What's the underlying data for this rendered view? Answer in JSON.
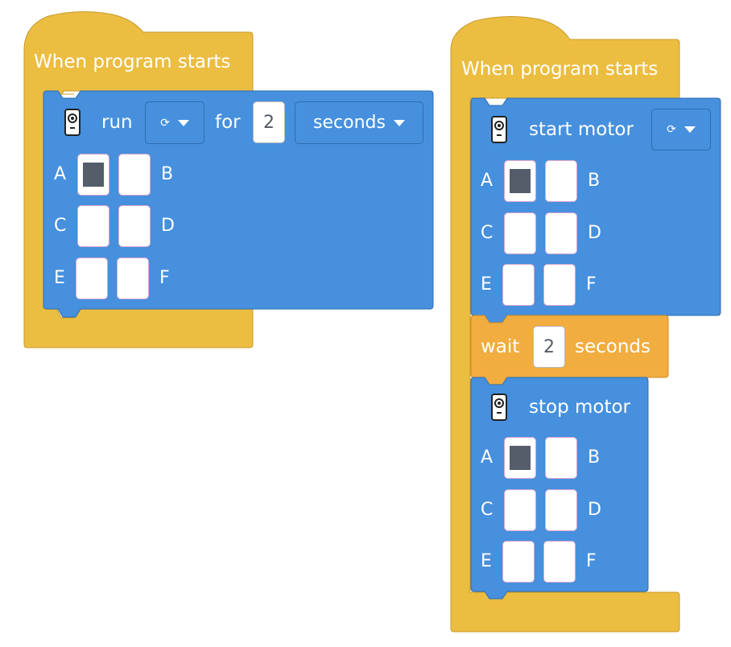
{
  "colors": {
    "hat": "#ebbd41",
    "motor": "#4690de",
    "wait": "#f1ad3f",
    "port_fill": "#555d6b"
  },
  "stack1": {
    "hat_label": "When program starts",
    "block": {
      "icon": "motor-icon",
      "run_label": "run",
      "direction": "⟳",
      "for_label": "for",
      "amount": "2",
      "unit": "seconds",
      "ports": [
        {
          "label": "A",
          "selected": true
        },
        {
          "label": "B",
          "selected": false
        },
        {
          "label": "C",
          "selected": false
        },
        {
          "label": "D",
          "selected": false
        },
        {
          "label": "E",
          "selected": false
        },
        {
          "label": "F",
          "selected": false
        }
      ]
    }
  },
  "stack2": {
    "hat_label": "When program starts",
    "start_block": {
      "icon": "motor-icon",
      "label": "start motor",
      "direction": "⟳",
      "ports": [
        {
          "label": "A",
          "selected": true
        },
        {
          "label": "B",
          "selected": false
        },
        {
          "label": "C",
          "selected": false
        },
        {
          "label": "D",
          "selected": false
        },
        {
          "label": "E",
          "selected": false
        },
        {
          "label": "F",
          "selected": false
        }
      ]
    },
    "wait_block": {
      "wait_label": "wait",
      "amount": "2",
      "unit_label": "seconds"
    },
    "stop_block": {
      "icon": "motor-icon",
      "label": "stop motor",
      "ports": [
        {
          "label": "A",
          "selected": true
        },
        {
          "label": "B",
          "selected": false
        },
        {
          "label": "C",
          "selected": false
        },
        {
          "label": "D",
          "selected": false
        },
        {
          "label": "E",
          "selected": false
        },
        {
          "label": "F",
          "selected": false
        }
      ]
    }
  }
}
